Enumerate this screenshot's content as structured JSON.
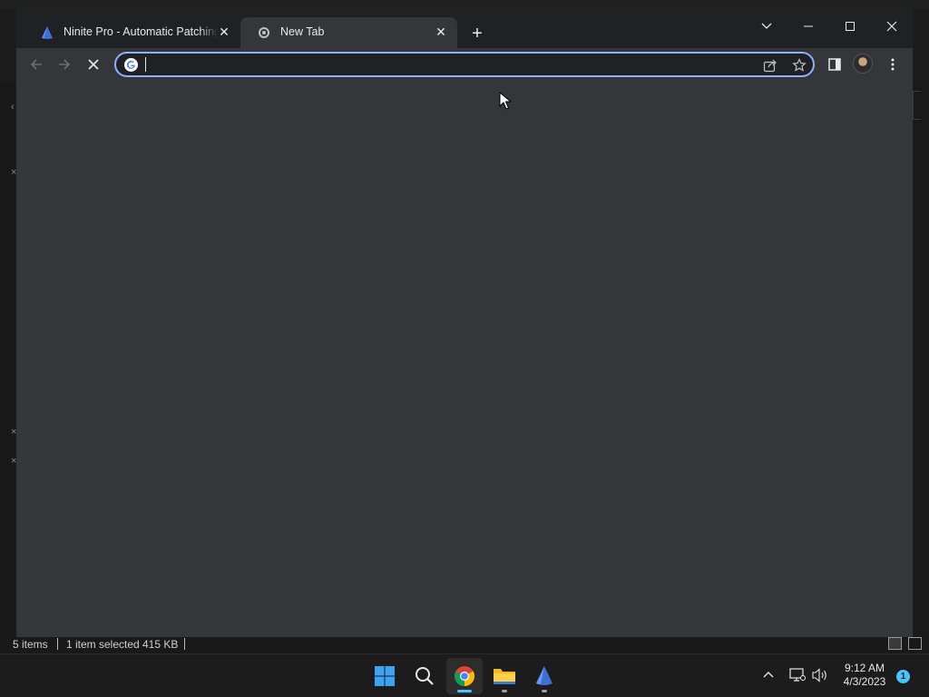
{
  "chrome": {
    "tabs": [
      {
        "title": "Ninite Pro - Automatic Patching",
        "favicon": "ninite-icon",
        "state": "inactive"
      },
      {
        "title": "New Tab",
        "favicon": "chrome-newtab-icon",
        "state": "active"
      }
    ],
    "omnibox": {
      "value": "",
      "placeholder": ""
    },
    "colors": {
      "frame": "#202124",
      "toolbar": "#35363a",
      "focus_ring": "#8ab4f8"
    }
  },
  "explorer_status": {
    "items": "5 items",
    "selection": "1 item selected",
    "size": "415 KB"
  },
  "taskbar": {
    "apps": [
      {
        "name": "start-button",
        "icon": "windows-logo-icon",
        "active": false
      },
      {
        "name": "search-button",
        "icon": "search-icon",
        "active": false
      },
      {
        "name": "chrome-app",
        "icon": "chrome-icon",
        "active": true
      },
      {
        "name": "file-explorer-app",
        "icon": "folder-icon",
        "active": false
      },
      {
        "name": "ninite-app",
        "icon": "ninite-icon",
        "active": false
      }
    ],
    "clock": {
      "time": "9:12 AM",
      "date": "4/3/2023"
    },
    "notifications": "1"
  }
}
